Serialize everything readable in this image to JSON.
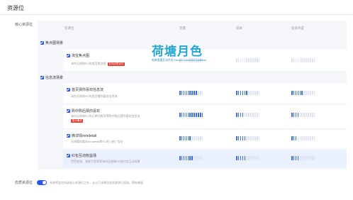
{
  "page": {
    "title": "资源位"
  },
  "section_label": "核心资源位",
  "table": {
    "headers": {
      "name": "资源位",
      "traffic": "流量",
      "cost": "成本",
      "competition": "竞争热度"
    }
  },
  "groups": [
    {
      "label": "焦点图场景",
      "rows": [
        {
          "name": "淘宝焦点图",
          "desc": "淘内无线和PC的首页焦点图",
          "tag": "支持创意优化",
          "levels": {
            "traffic": 0,
            "cost": 0,
            "competition": 0
          }
        }
      ]
    },
    {
      "label": "信息流场景",
      "rows": [
        {
          "name": "首页猜你喜欢信息流",
          "desc": "淘内无线和PC的首页猜你喜欢信息流",
          "tag": "",
          "levels": {
            "traffic": 9,
            "cost": 6,
            "competition": 6
          }
        },
        {
          "name": "购中购后猜你喜欢",
          "desc": "淘内无线和PC的订单列表页等购中购后猜你喜欢信息流",
          "tag": "强大曝光",
          "levels": {
            "traffic": 12,
            "cost": 4,
            "competition": 4
          }
        },
        {
          "name": "微详情mmdetail",
          "desc": "无线猜你喜欢mmdetail和PC的上新广告位",
          "tag": "",
          "levels": {
            "traffic": 6,
            "cost": 5,
            "competition": 3
          }
        },
        {
          "name": "红包互动权益场",
          "desc": "芭芭农场、淘金币签到等淘内无线和PC的红包互动场景",
          "tag": "",
          "levels": {
            "traffic": 7,
            "cost": 5,
            "competition": 4
          }
        }
      ]
    }
  ],
  "watermark": {
    "brand": "荷塘月色",
    "subtitle": "电商直通互动平台 Electric connected platform"
  },
  "premium": {
    "label": "优质资源位",
    "enabled": true,
    "desc": "系统将会在所选核心资源位之外，从以下场景优选资源进行投放，帮你拿量"
  },
  "colors": {
    "accent": "#2a57e8",
    "bar_on": "#3d6ee8",
    "bar_off": "#dde3f3",
    "tag": "#e3362f",
    "row_highlight": "#eaf0fe"
  }
}
